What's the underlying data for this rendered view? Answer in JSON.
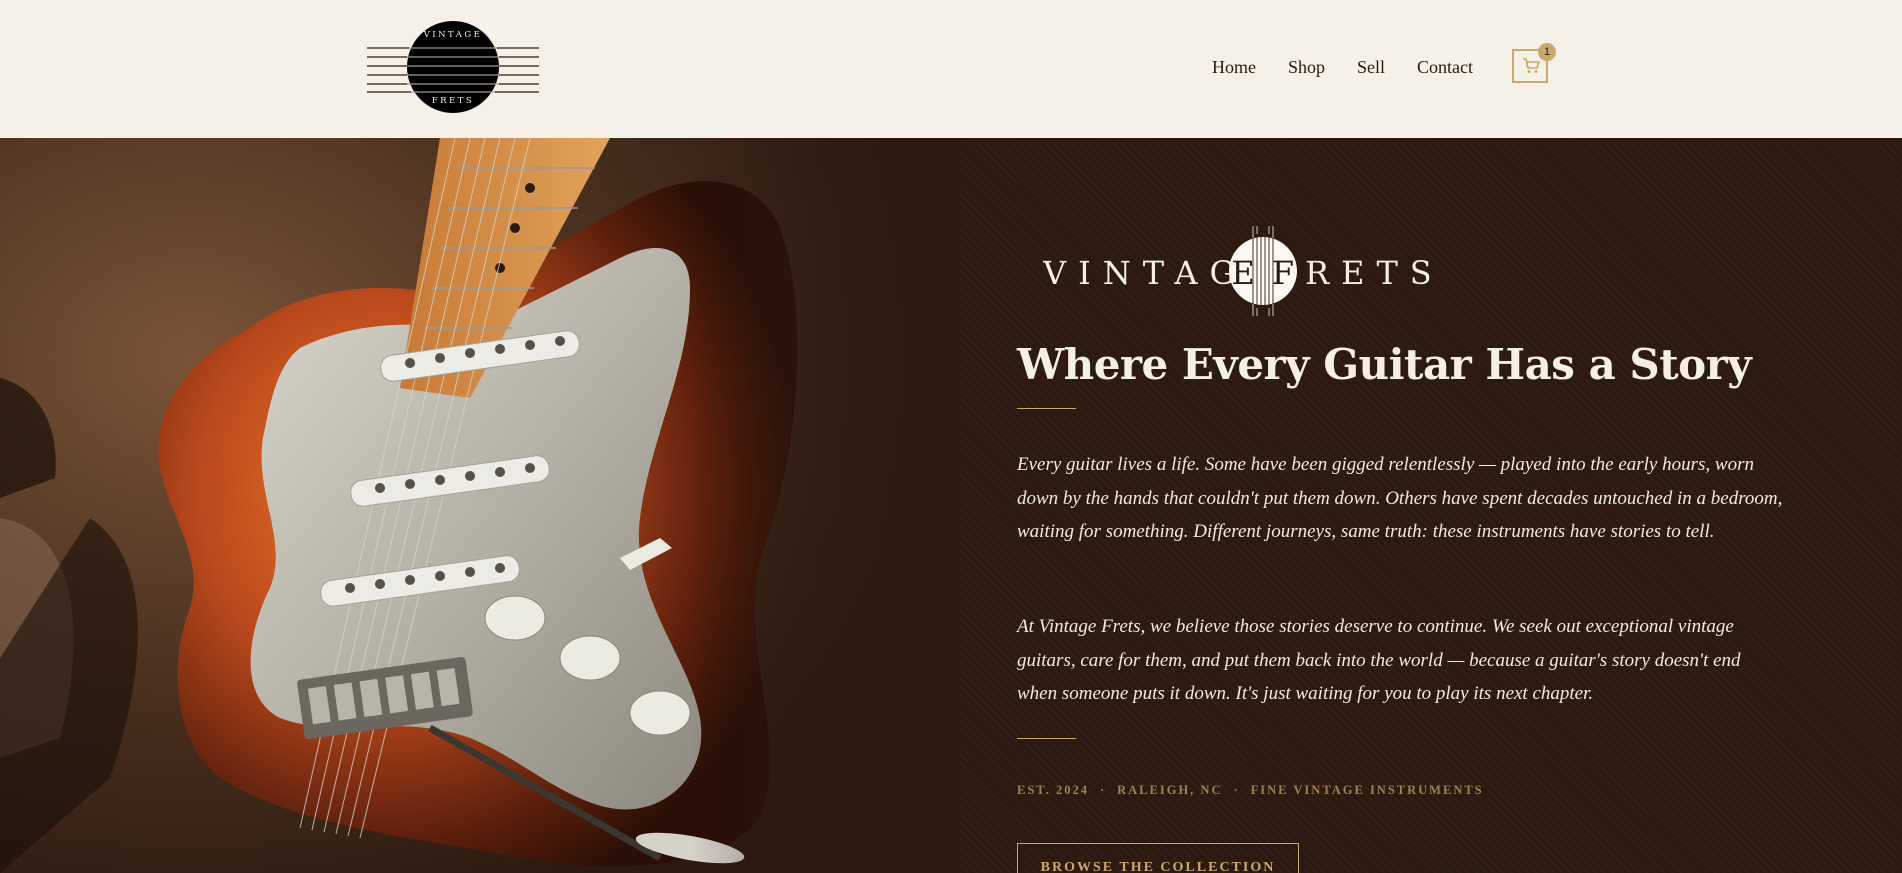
{
  "header": {
    "logo_top_text": "VINTAGE",
    "logo_bottom_text": "FRETS",
    "nav": [
      "Home",
      "Shop",
      "Sell",
      "Contact"
    ],
    "cart_icon": "cart-icon",
    "cart_count": "1"
  },
  "hero": {
    "image": "electric-guitar-sunburst-photo",
    "wordmark_left": "VINTAG",
    "wordmark_right": "RETS",
    "wordmark_disc_letters": [
      "E",
      "F"
    ],
    "headline": "Where Every Guitar Has a Story",
    "paragraphs": [
      "Every guitar lives a life. Some have been gigged relentlessly — played into the early hours, worn down by the hands that couldn't put them down. Others have spent decades untouched in a bedroom, waiting for something. Different journeys, same truth: these instruments have stories to tell.",
      "At Vintage Frets, we believe those stories deserve to continue. We seek out exceptional vintage guitars, care for them, and put them back into the world — because a guitar's story doesn't end when someone puts it down. It's just waiting for you to play its next chapter."
    ],
    "meta": [
      "EST. 2024",
      "·",
      "RALEIGH, NC",
      "·",
      "FINE VINTAGE INSTRUMENTS"
    ],
    "cta": "BROWSE THE COLLECTION"
  },
  "colors": {
    "cream": "#f5f0e8",
    "dark_brown": "#2c1a10",
    "gold_accent": "#c9a869"
  }
}
